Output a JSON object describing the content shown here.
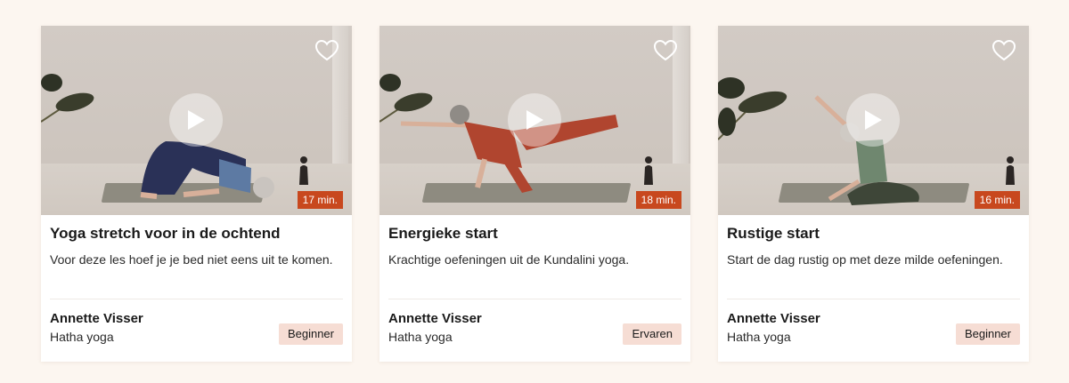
{
  "classes": [
    {
      "title": "Yoga stretch voor in de ochtend",
      "description": "Voor deze les hoef je je bed niet eens uit te komen.",
      "duration": "17 min.",
      "instructor": "Annette Visser",
      "style": "Hatha yoga",
      "level": "Beginner",
      "favorited": false,
      "thumbnail_icon": "play-icon"
    },
    {
      "title": "Energieke start",
      "description": "Krachtige oefeningen uit de Kundalini yoga.",
      "duration": "18 min.",
      "instructor": "Annette Visser",
      "style": "Hatha yoga",
      "level": "Ervaren",
      "favorited": false,
      "thumbnail_icon": "play-icon"
    },
    {
      "title": "Rustige start",
      "description": "Start de dag rustig op met deze milde oefeningen.",
      "duration": "16 min.",
      "instructor": "Annette Visser",
      "style": "Hatha yoga",
      "level": "Beginner",
      "favorited": false,
      "thumbnail_icon": "play-icon"
    }
  ],
  "colors": {
    "page_background": "#fcf6f0",
    "duration_badge": "#c8481e",
    "level_badge": "#f6ddd4"
  }
}
